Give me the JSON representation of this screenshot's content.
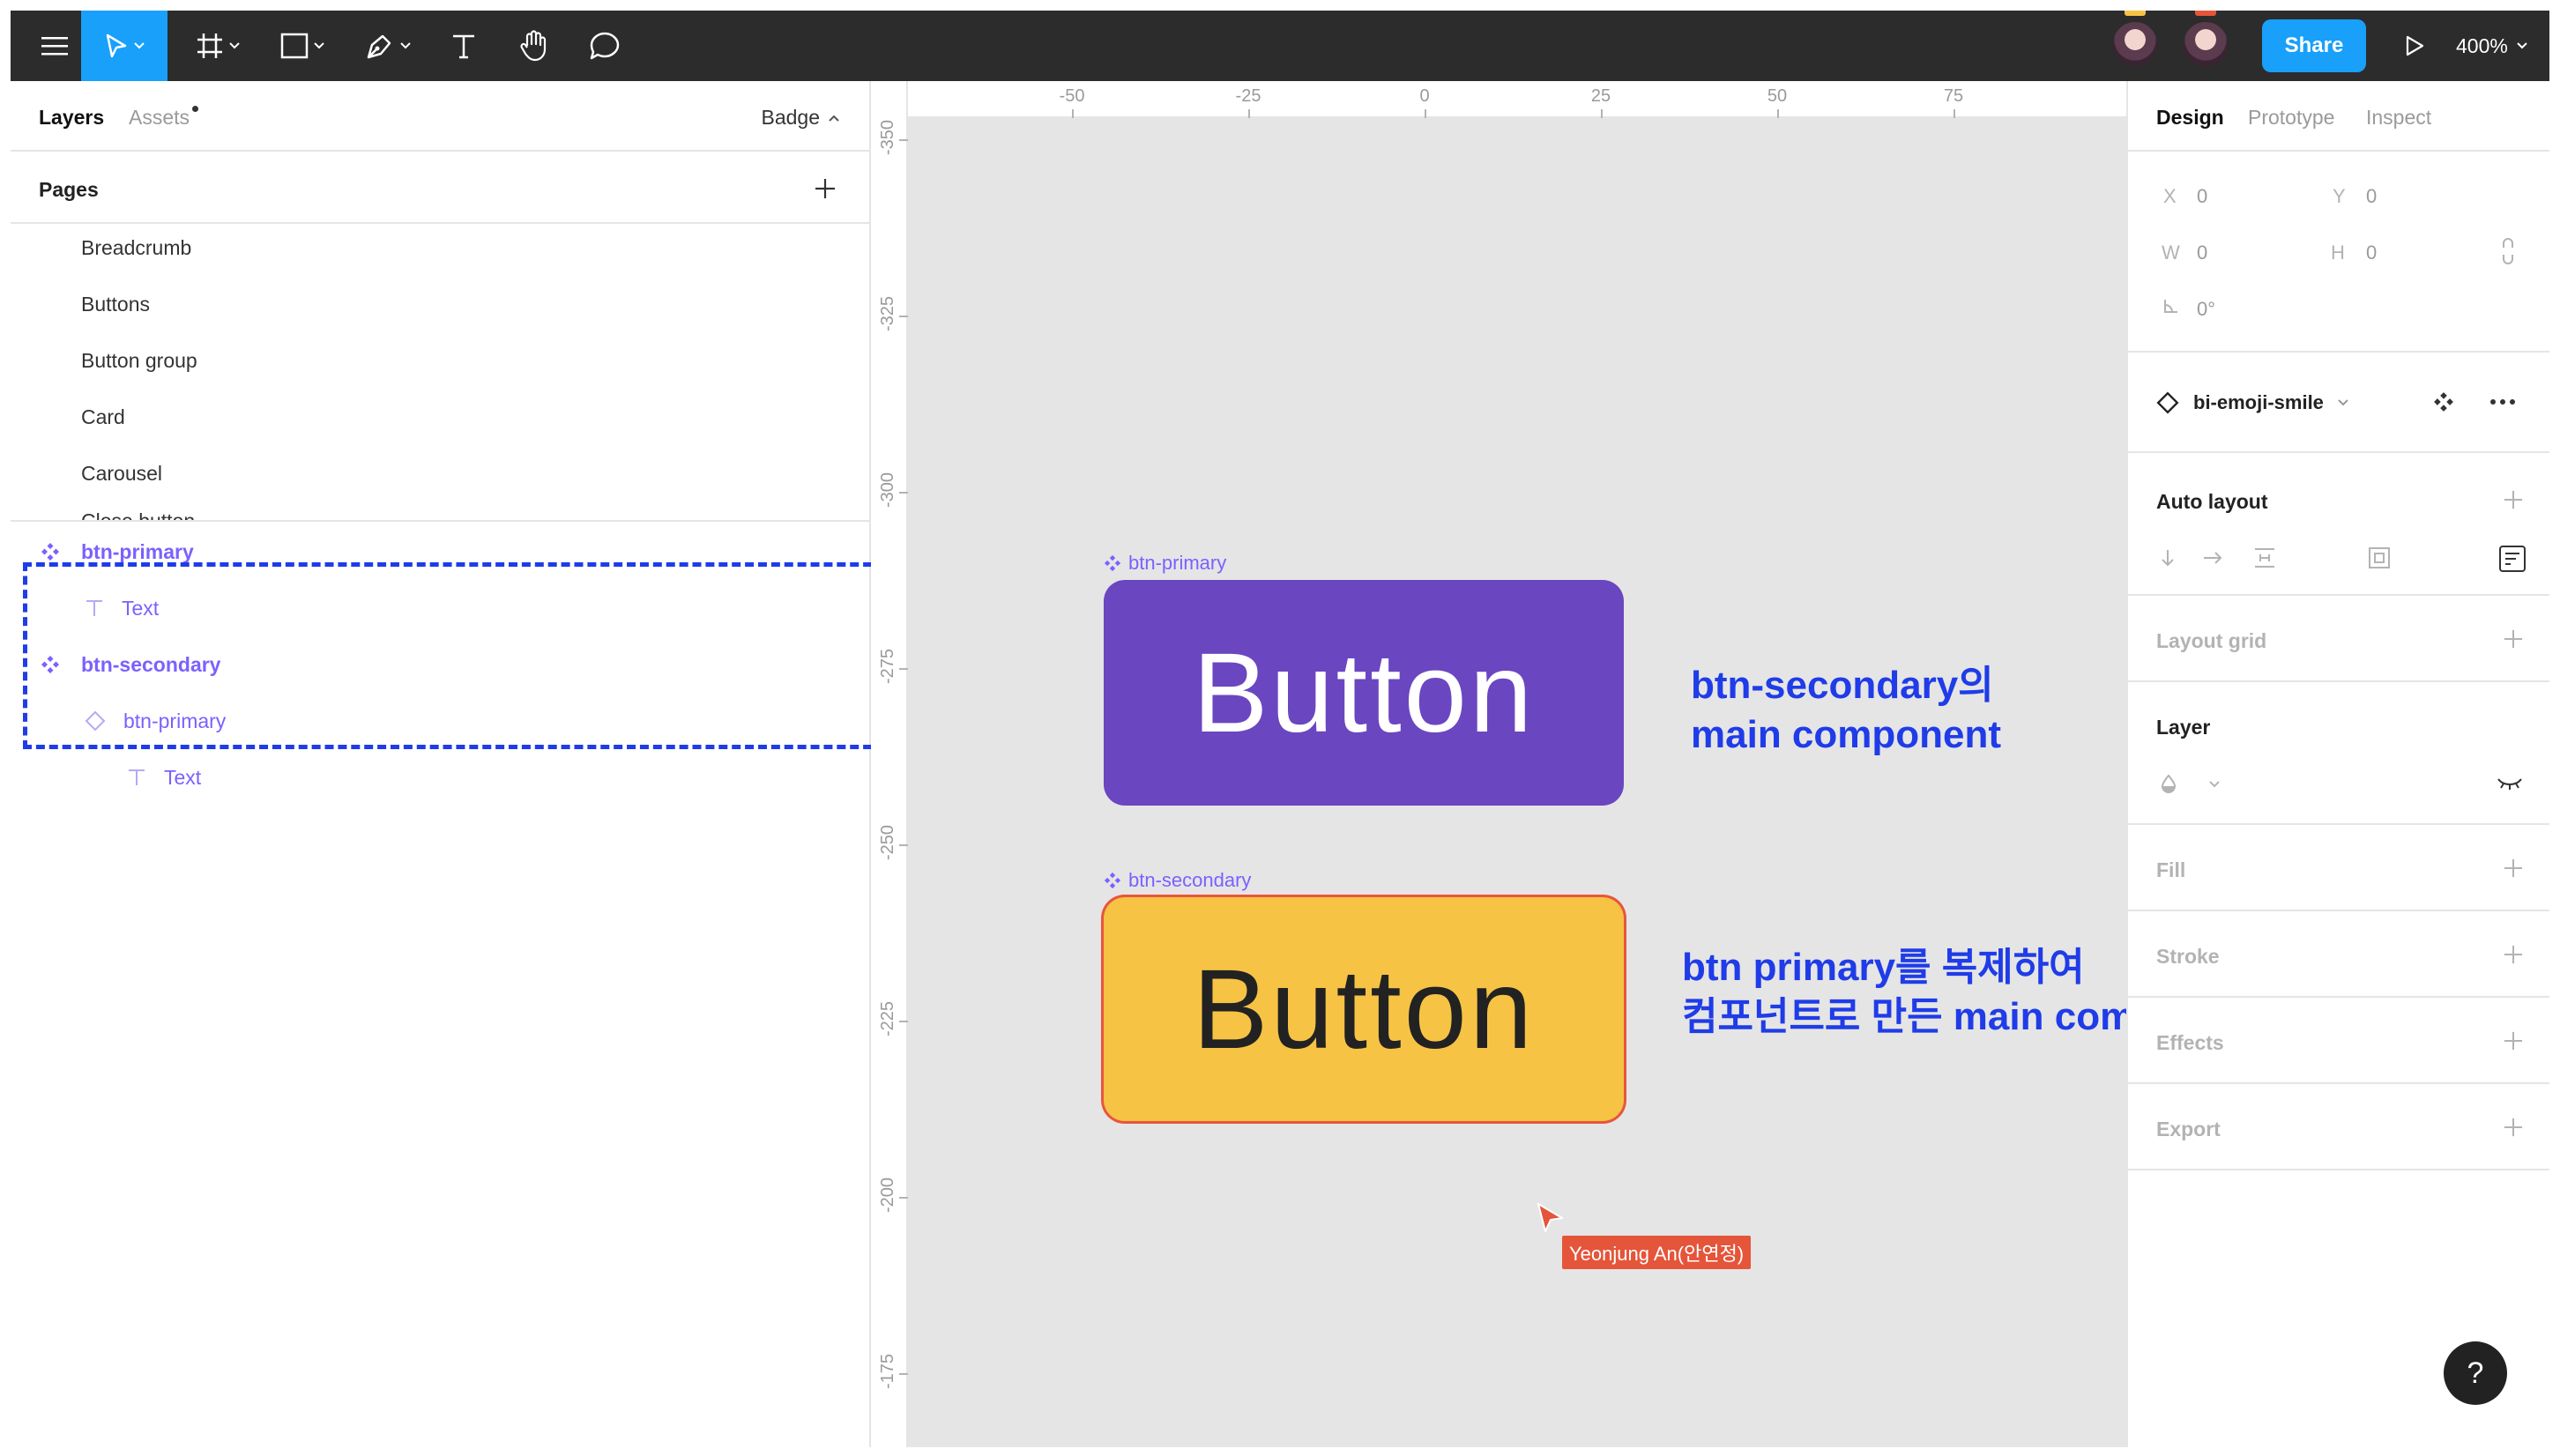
{
  "toolbar": {
    "share_label": "Share",
    "zoom_label": "400%"
  },
  "left_panel": {
    "tabs": [
      {
        "label": "Layers"
      },
      {
        "label": "Assets"
      }
    ],
    "current_page": "Badge",
    "pages_title": "Pages",
    "pages": [
      "Breadcrumb",
      "Buttons",
      "Button group",
      "Card",
      "Carousel",
      "Close button"
    ],
    "layers": [
      {
        "label": "btn-primary",
        "type": "component"
      },
      {
        "label": "Text",
        "type": "text"
      },
      {
        "label": "btn-secondary",
        "type": "component"
      },
      {
        "label": "btn-primary",
        "type": "instance"
      },
      {
        "label": "Text",
        "type": "text"
      }
    ]
  },
  "canvas": {
    "ruler_top": [
      "-50",
      "-25",
      "0",
      "25",
      "50",
      "75"
    ],
    "ruler_left": [
      "-350",
      "-325",
      "-300",
      "-275",
      "-250",
      "-225",
      "-200",
      "-175"
    ],
    "frames": [
      {
        "name": "btn-primary",
        "text": "Button",
        "color": "#6b46c1"
      },
      {
        "name": "btn-secondary",
        "text": "Button",
        "color": "#f6c344"
      }
    ],
    "annotations": [
      {
        "line1": "btn-secondary의",
        "line2": "main component"
      },
      {
        "line1": "btn primary를 복제하여",
        "line2": "컴포넌트로 만든 main component"
      }
    ],
    "collaborator_cursor": "Yeonjung An(안연정)"
  },
  "right_panel": {
    "tabs": [
      {
        "label": "Design"
      },
      {
        "label": "Prototype"
      },
      {
        "label": "Inspect"
      }
    ],
    "x_label": "X",
    "x_value": "0",
    "y_label": "Y",
    "y_value": "0",
    "w_label": "W",
    "w_value": "0",
    "h_label": "H",
    "h_value": "0",
    "rotation_value": "0°",
    "instance_name": "bi-emoji-smile",
    "sections": [
      {
        "title": "Auto layout",
        "active": true
      },
      {
        "title": "Layout grid",
        "active": false
      },
      {
        "title": "Layer",
        "active": true
      },
      {
        "title": "Fill",
        "active": false
      },
      {
        "title": "Stroke",
        "active": false
      },
      {
        "title": "Effects",
        "active": false
      },
      {
        "title": "Export",
        "active": false
      }
    ]
  },
  "help_label": "?",
  "colors": {
    "accent": "#18a0fb",
    "component_purple": "#7b61ff",
    "annotation_blue": "#1f3ce8",
    "selection_red": "#e8553c"
  }
}
